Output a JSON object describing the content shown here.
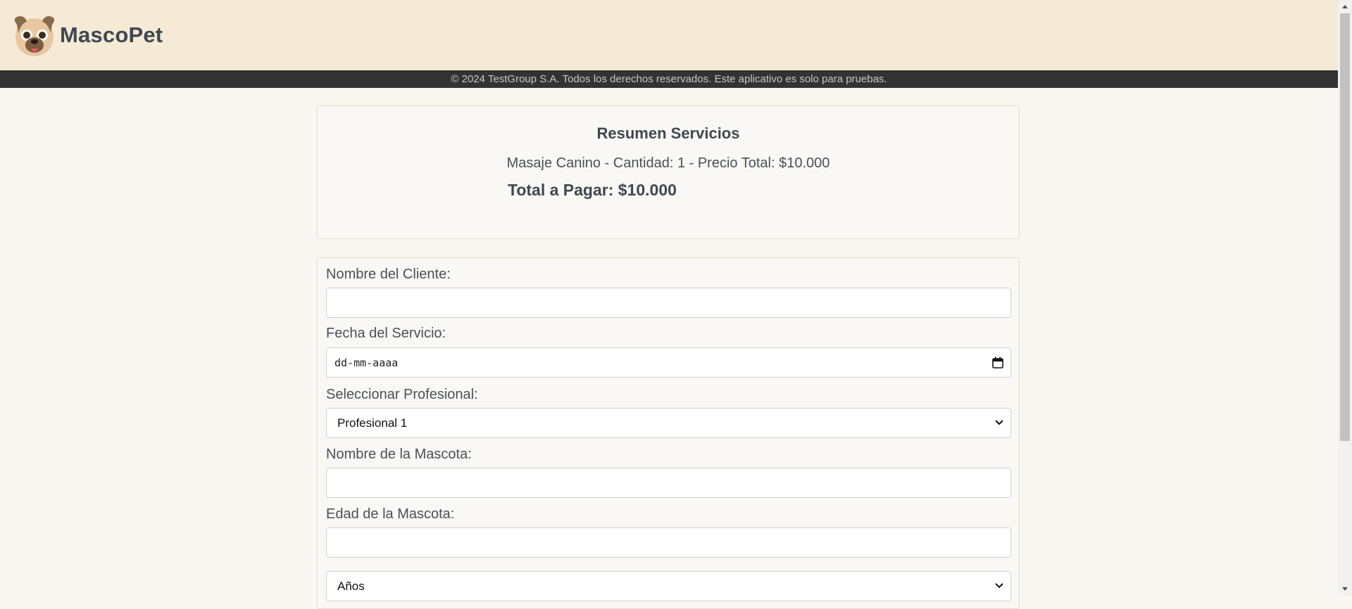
{
  "header": {
    "brand": "MascoPet",
    "logo_icon": "pug-dog-icon"
  },
  "footer": {
    "text": "© 2024 TestGroup S.A. Todos los derechos reservados. Este aplicativo es solo para pruebas."
  },
  "summary": {
    "title": "Resumen Servicios",
    "line": "Masaje Canino - Cantidad: 1 - Precio Total: $10.000",
    "total": "Total a Pagar: $10.000"
  },
  "form": {
    "client_name_label": "Nombre del Cliente:",
    "client_name_value": "",
    "date_label": "Fecha del Servicio:",
    "date_placeholder": "dd-mm-aaaa",
    "professional_label": "Seleccionar Profesional:",
    "professional_selected": "Profesional 1",
    "pet_name_label": "Nombre de la Mascota:",
    "pet_name_value": "",
    "pet_age_label": "Edad de la Mascota:",
    "pet_age_value": "",
    "age_unit_selected": "Años"
  },
  "colors": {
    "header_bg": "#f5ead6",
    "footer_bg": "#333333",
    "page_bg": "#f9f7f1"
  }
}
